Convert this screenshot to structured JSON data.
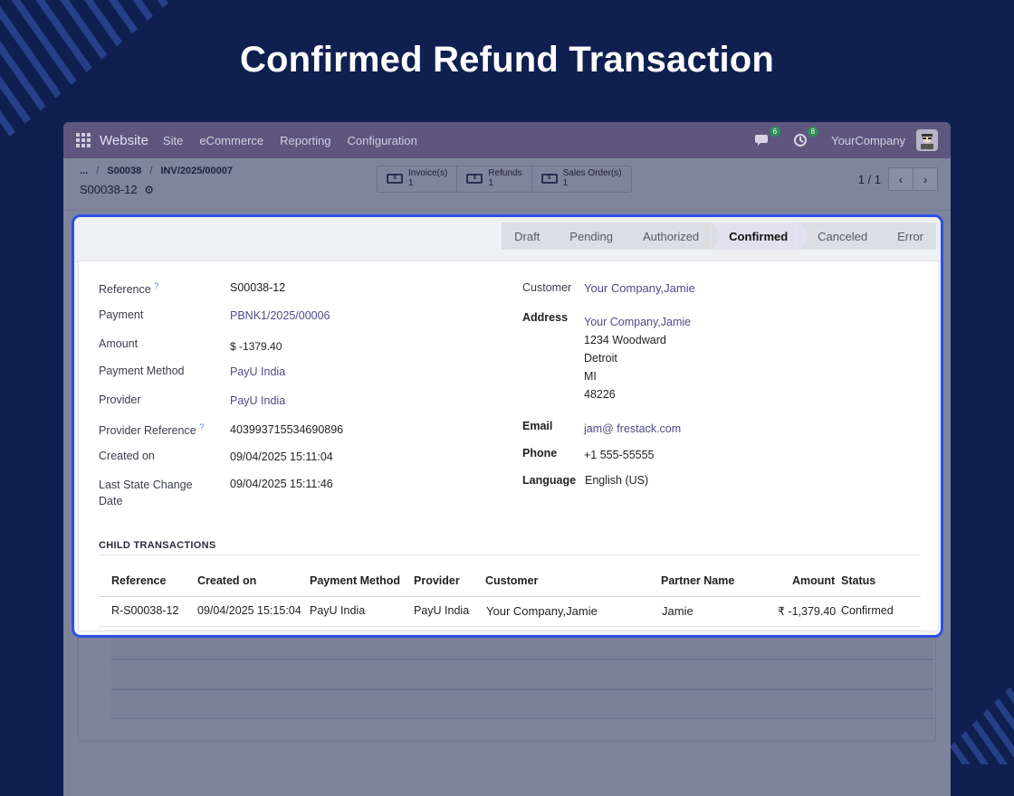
{
  "headline": "Confirmed Refund Transaction",
  "topbar": {
    "app_name": "Website",
    "menu": [
      "Site",
      "eCommerce",
      "Reporting",
      "Configuration"
    ],
    "messages_count": "6",
    "activities_count": "8",
    "company": "YourCompany"
  },
  "breadcrumb": {
    "ellipsis": "...",
    "items": [
      "S00038",
      "INV/2025/00007"
    ],
    "record": "S00038-12"
  },
  "smart_buttons": [
    {
      "label": "Invoice(s)",
      "count": "1"
    },
    {
      "label": "Refunds",
      "count": "1"
    },
    {
      "label": "Sales Order(s)",
      "count": "1"
    }
  ],
  "pager": {
    "text": "1 / 1"
  },
  "statusbar": {
    "stages": [
      "Draft",
      "Pending",
      "Authorized",
      "Confirmed",
      "Canceled",
      "Error"
    ],
    "active": "Confirmed"
  },
  "left_fields": {
    "reference": {
      "label": "Reference",
      "value": "S00038-12"
    },
    "payment": {
      "label": "Payment",
      "value": "PBNK1/2025/00006"
    },
    "amount": {
      "label": "Amount",
      "value": "$ -1379.40"
    },
    "payment_method": {
      "label": "Payment Method",
      "value": "PayU India"
    },
    "provider": {
      "label": "Provider",
      "value": "PayU India"
    },
    "provider_reference": {
      "label": "Provider Reference",
      "value": "403993715534690896"
    },
    "created_on": {
      "label": "Created on",
      "value": "09/04/2025 15:11:04"
    },
    "last_state_change_line1": "Last State Change",
    "last_state_change_line2": "Date",
    "last_state_change_value": "09/04/2025 15:11:46"
  },
  "right_fields": {
    "customer": {
      "label": "Customer",
      "value": "Your Company,Jamie"
    },
    "address": {
      "label": "Address",
      "name": "Your Company,Jamie",
      "street": "1234 Woodward",
      "city": "Detroit",
      "state": "MI",
      "zip": "48226"
    },
    "email": {
      "label": "Email",
      "value": "jam@ frestack.com"
    },
    "phone": {
      "label": "Phone",
      "value": "+1 555-55555"
    },
    "language": {
      "label": "Language",
      "value": "English (US)"
    }
  },
  "child_transactions": {
    "title": "CHILD TRANSACTIONS",
    "columns": [
      "Reference",
      "Created on",
      "Payment Method",
      "Provider",
      "Customer",
      "Partner Name",
      "Amount",
      "Status"
    ],
    "rows": [
      [
        "R-S00038-12",
        "09/04/2025 15:15:04",
        "PayU India",
        "PayU India",
        "Your Company,Jamie",
        "Jamie",
        "₹ -1,379.40",
        "Confirmed"
      ]
    ]
  }
}
